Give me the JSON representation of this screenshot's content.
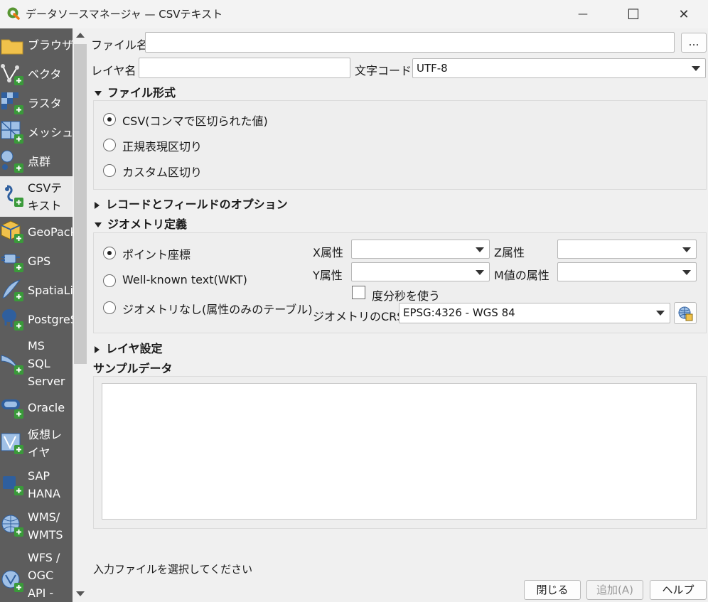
{
  "window": {
    "title": "データソースマネージャ — CSVテキスト",
    "minimize_glyph": "—",
    "maximize_glyph": "☐",
    "close_glyph": "✕"
  },
  "sidebar": {
    "items": [
      {
        "label": "ブラウザ",
        "icon": "folder-icon"
      },
      {
        "label": "ベクタ",
        "icon": "vector-add-icon"
      },
      {
        "label": "ラスタ",
        "icon": "raster-add-icon"
      },
      {
        "label": "メッシュ",
        "icon": "mesh-add-icon"
      },
      {
        "label": "点群",
        "icon": "pointcloud-add-icon"
      },
      {
        "label": "CSVテ\nキスト",
        "icon": "csv-add-icon"
      },
      {
        "label": "GeoPack",
        "icon": "geopackage-add-icon"
      },
      {
        "label": "GPS",
        "icon": "gps-add-icon"
      },
      {
        "label": "SpatiaLit",
        "icon": "spatialite-add-icon"
      },
      {
        "label": "PostgreS",
        "icon": "postgres-add-icon"
      },
      {
        "label": "MS\nSQL\nServer",
        "icon": "mssql-add-icon"
      },
      {
        "label": "Oracle",
        "icon": "oracle-add-icon"
      },
      {
        "label": "仮想レ\nイヤ",
        "icon": "virtual-layer-add-icon"
      },
      {
        "label": "SAP\nHANA",
        "icon": "hana-add-icon"
      },
      {
        "label": "WMS/\nWMTS",
        "icon": "wms-add-icon"
      },
      {
        "label": "WFS /\nOGC\nAPI -",
        "icon": "wfs-add-icon"
      }
    ]
  },
  "form": {
    "file_name_label": "ファイル名",
    "file_name_value": "",
    "browse_label": "…",
    "layer_name_label": "レイヤ名",
    "layer_name_value": "",
    "encoding_label": "文字コード",
    "encoding_value": "UTF-8"
  },
  "file_format": {
    "header": "ファイル形式",
    "options": [
      "CSV(コンマで区切られた値)",
      "正規表現区切り",
      "カスタム区切り"
    ],
    "selected_index": 0
  },
  "record_options": {
    "header": "レコードとフィールドのオプション"
  },
  "geometry": {
    "header": "ジオメトリ定義",
    "options": [
      "ポイント座標",
      "Well-known text(WKT)",
      "ジオメトリなし(属性のみのテーブル)"
    ],
    "selected_index": 0,
    "x_label": "X属性",
    "x_value": "",
    "y_label": "Y属性",
    "y_value": "",
    "z_label": "Z属性",
    "z_value": "",
    "m_label": "M値の属性",
    "m_value": "",
    "dms_label": "度分秒を使う",
    "dms_checked": false,
    "crs_label": "ジオメトリのCRS",
    "crs_value": "EPSG:4326 - WGS 84"
  },
  "layer_settings": {
    "header": "レイヤ設定"
  },
  "sample": {
    "header": "サンプルデータ"
  },
  "status": {
    "message": "入力ファイルを選択してください"
  },
  "buttons": {
    "close": "閉じる",
    "add": "追加(A)",
    "help": "ヘルプ"
  },
  "colors": {
    "sidebar_bg": "#5d5d5d",
    "selected_item_bg": "#eaeaea",
    "qgis_green": "#589632",
    "plus_green": "#3a9a3a"
  }
}
